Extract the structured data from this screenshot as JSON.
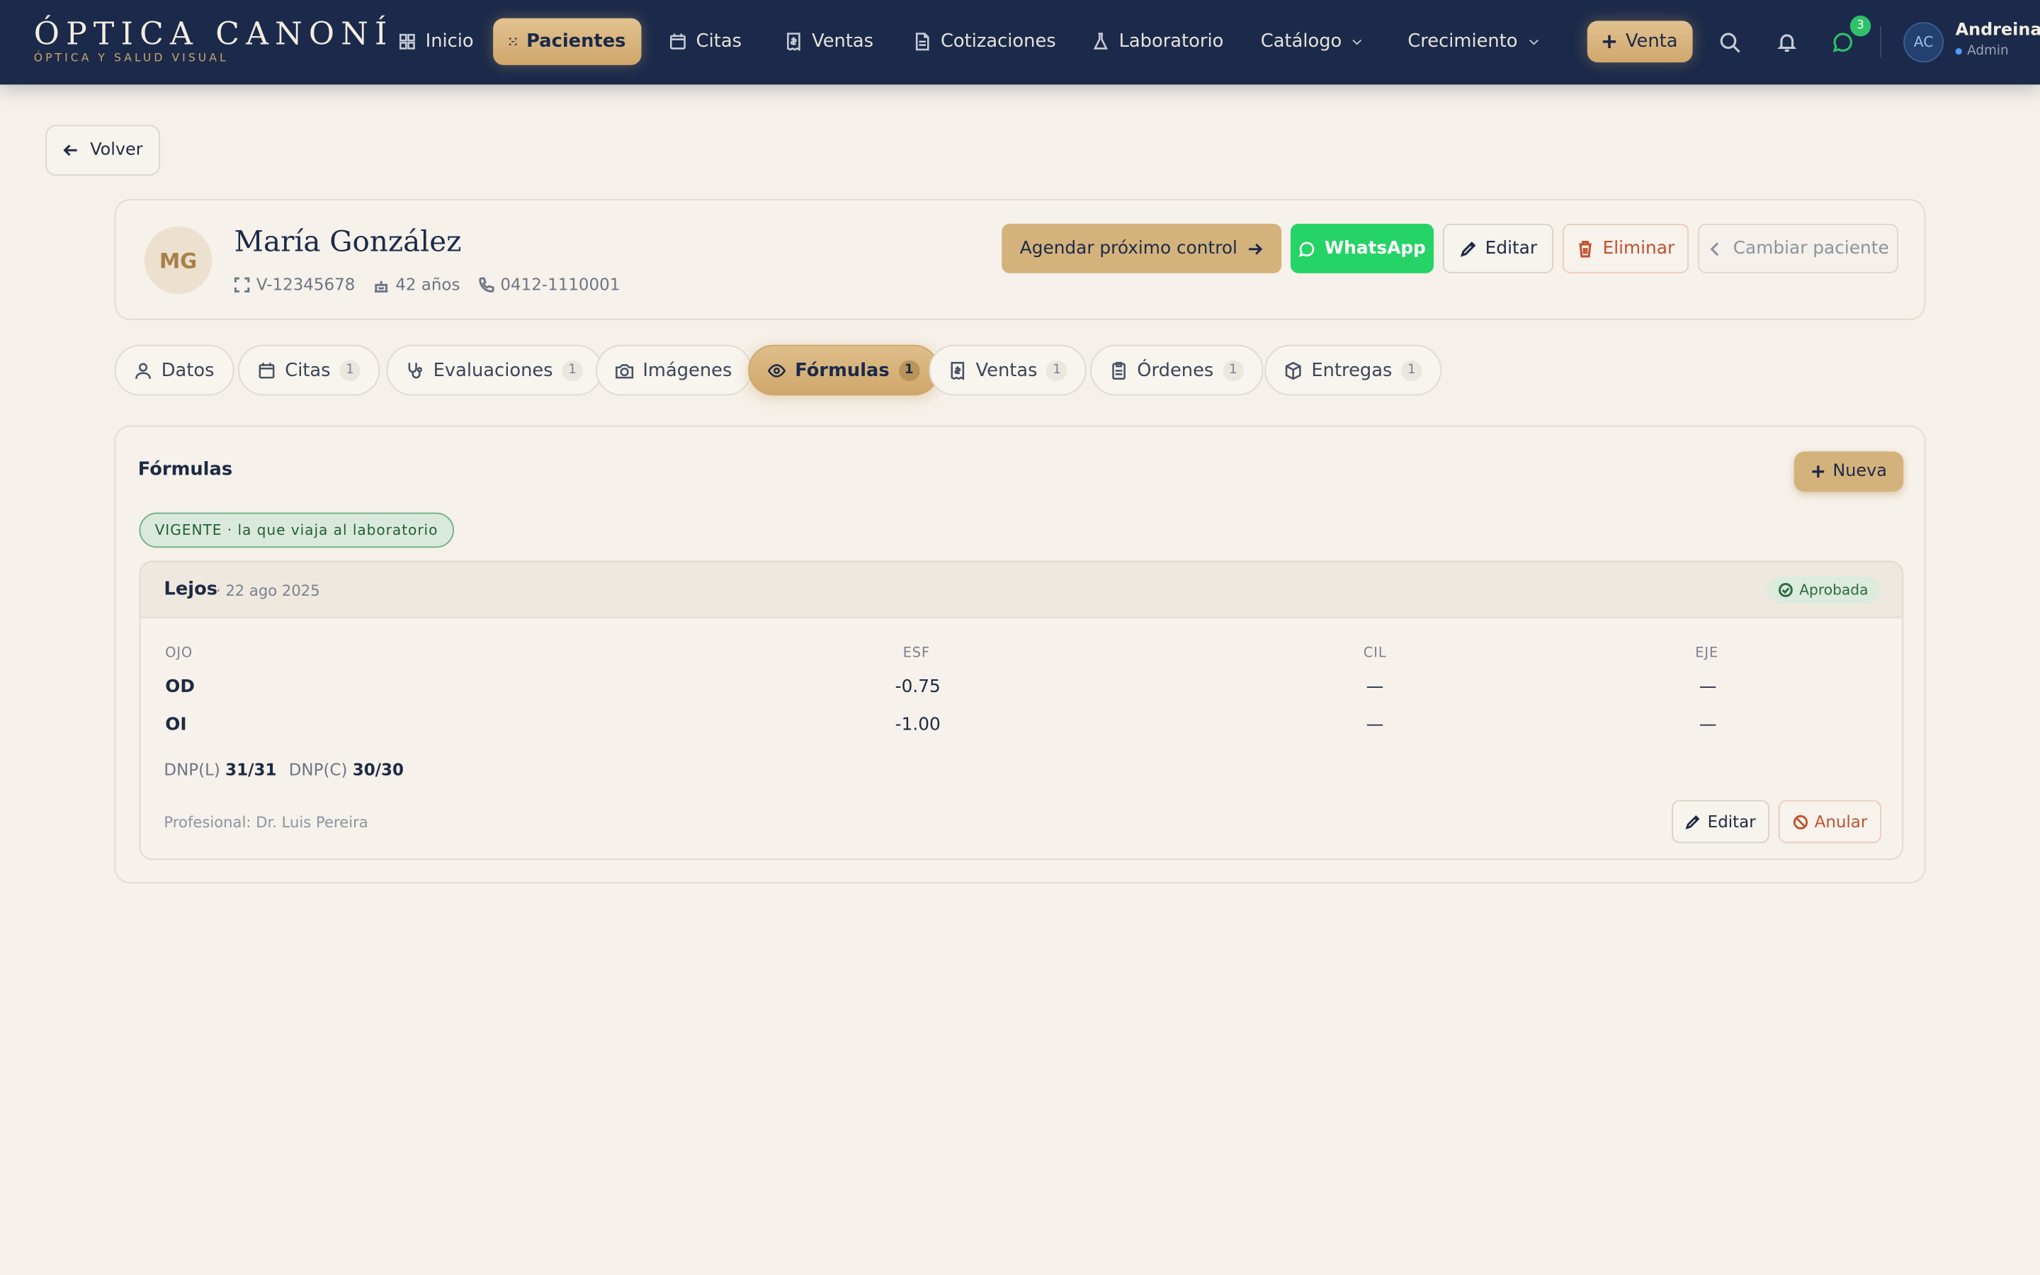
{
  "brand": {
    "title": "ÓPTICA CANONÍ",
    "subtitle": "ÓPTICA Y SALUD VISUAL"
  },
  "nav": {
    "items": [
      {
        "label": "Inicio",
        "icon": "grid-icon"
      },
      {
        "label": "Pacientes",
        "icon": "scan-icon",
        "active": true
      },
      {
        "label": "Citas",
        "icon": "calendar-icon"
      },
      {
        "label": "Ventas",
        "icon": "receipt-icon"
      },
      {
        "label": "Cotizaciones",
        "icon": "document-icon"
      },
      {
        "label": "Laboratorio",
        "icon": "flask-icon"
      },
      {
        "label": "Catálogo",
        "icon": "chevron-down-icon"
      },
      {
        "label": "Crecimiento",
        "icon": "chevron-down-icon"
      }
    ],
    "venta_label": "Venta",
    "messages_count": "3",
    "user": {
      "initials": "AC",
      "name": "Andreina",
      "role": "Admin"
    }
  },
  "back_label": "Volver",
  "patient": {
    "initials": "MG",
    "name": "María González",
    "id_doc": "V-12345678",
    "age": "42 años",
    "phone": "0412-1110001",
    "actions": {
      "agendar": "Agendar próximo control",
      "whatsapp": "WhatsApp",
      "editar": "Editar",
      "eliminar": "Eliminar",
      "cambiar": "Cambiar paciente"
    }
  },
  "tabs": [
    {
      "label": "Datos",
      "count": ""
    },
    {
      "label": "Citas",
      "count": "1"
    },
    {
      "label": "Evaluaciones",
      "count": "1"
    },
    {
      "label": "Imágenes",
      "count": ""
    },
    {
      "label": "Fórmulas",
      "count": "1",
      "active": true
    },
    {
      "label": "Ventas",
      "count": "1"
    },
    {
      "label": "Órdenes",
      "count": "1"
    },
    {
      "label": "Entregas",
      "count": "1"
    }
  ],
  "formulas": {
    "title": "Fórmulas",
    "new_label": "Nueva",
    "vigente_label": "VIGENTE · la que viaja al laboratorio",
    "card": {
      "type": "Lejos",
      "date": "· 22 ago 2025",
      "status": "Aprobada",
      "headers": [
        "OJO",
        "ESF",
        "CIL",
        "EJE"
      ],
      "rows": [
        [
          "OD",
          "-0.75",
          "—",
          "—"
        ],
        [
          "OI",
          "-1.00",
          "—",
          "—"
        ]
      ],
      "dnp_l_label": "DNP(L)",
      "dnp_l_value": "31/31",
      "dnp_c_label": "DNP(C)",
      "dnp_c_value": "30/30",
      "professional": "Profesional: Dr. Luis Pereira",
      "edit_label": "Editar",
      "cancel_label": "Anular"
    }
  },
  "colors": {
    "nav_bg": "#1b2a4a",
    "accent_gold": "#d4b27b",
    "whatsapp_green": "#25d366",
    "danger": "#c0512f",
    "page_bg": "#f5f0e9"
  }
}
